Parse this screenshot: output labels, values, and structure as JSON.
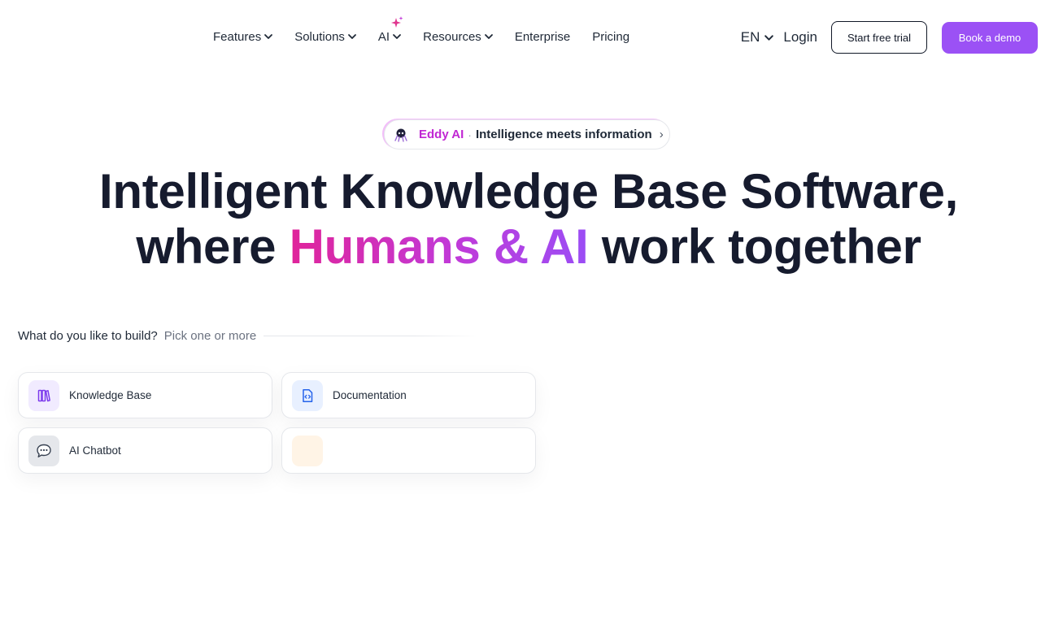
{
  "nav": {
    "items": [
      {
        "label": "Features",
        "has_dropdown": true
      },
      {
        "label": "Solutions",
        "has_dropdown": true
      },
      {
        "label": "AI",
        "has_dropdown": true,
        "icon": "sparkle-icon"
      },
      {
        "label": "Resources",
        "has_dropdown": true
      },
      {
        "label": "Enterprise",
        "has_dropdown": false
      },
      {
        "label": "Pricing",
        "has_dropdown": false
      }
    ],
    "language": "EN",
    "login": "Login",
    "trial_button": "Start free trial",
    "demo_button": "Book a demo"
  },
  "hero": {
    "pill_brand": "Eddy AI",
    "pill_separator": "·",
    "pill_text": "Intelligence meets information",
    "pill_arrow": "›",
    "headline_line1": "Intelligent Knowledge Base Software,",
    "headline_line2_start": "where ",
    "headline_line2_highlight": "Humans & AI",
    "headline_line2_end": " work together"
  },
  "builder": {
    "question": "What do you like to build?",
    "hint": "Pick one or more",
    "options": [
      {
        "label": "Knowledge Base",
        "icon": "books-icon"
      },
      {
        "label": "Documentation",
        "icon": "code-file-icon"
      },
      {
        "label": "AI Chatbot",
        "icon": "chat-bubble-icon"
      },
      {
        "label": "",
        "icon": "blank-icon"
      }
    ]
  },
  "colors": {
    "accent_purple": "#9b51f5",
    "highlight_pink": "#e0249a",
    "brand_magenta": "#c026d3",
    "text_dark": "#161b2e"
  }
}
